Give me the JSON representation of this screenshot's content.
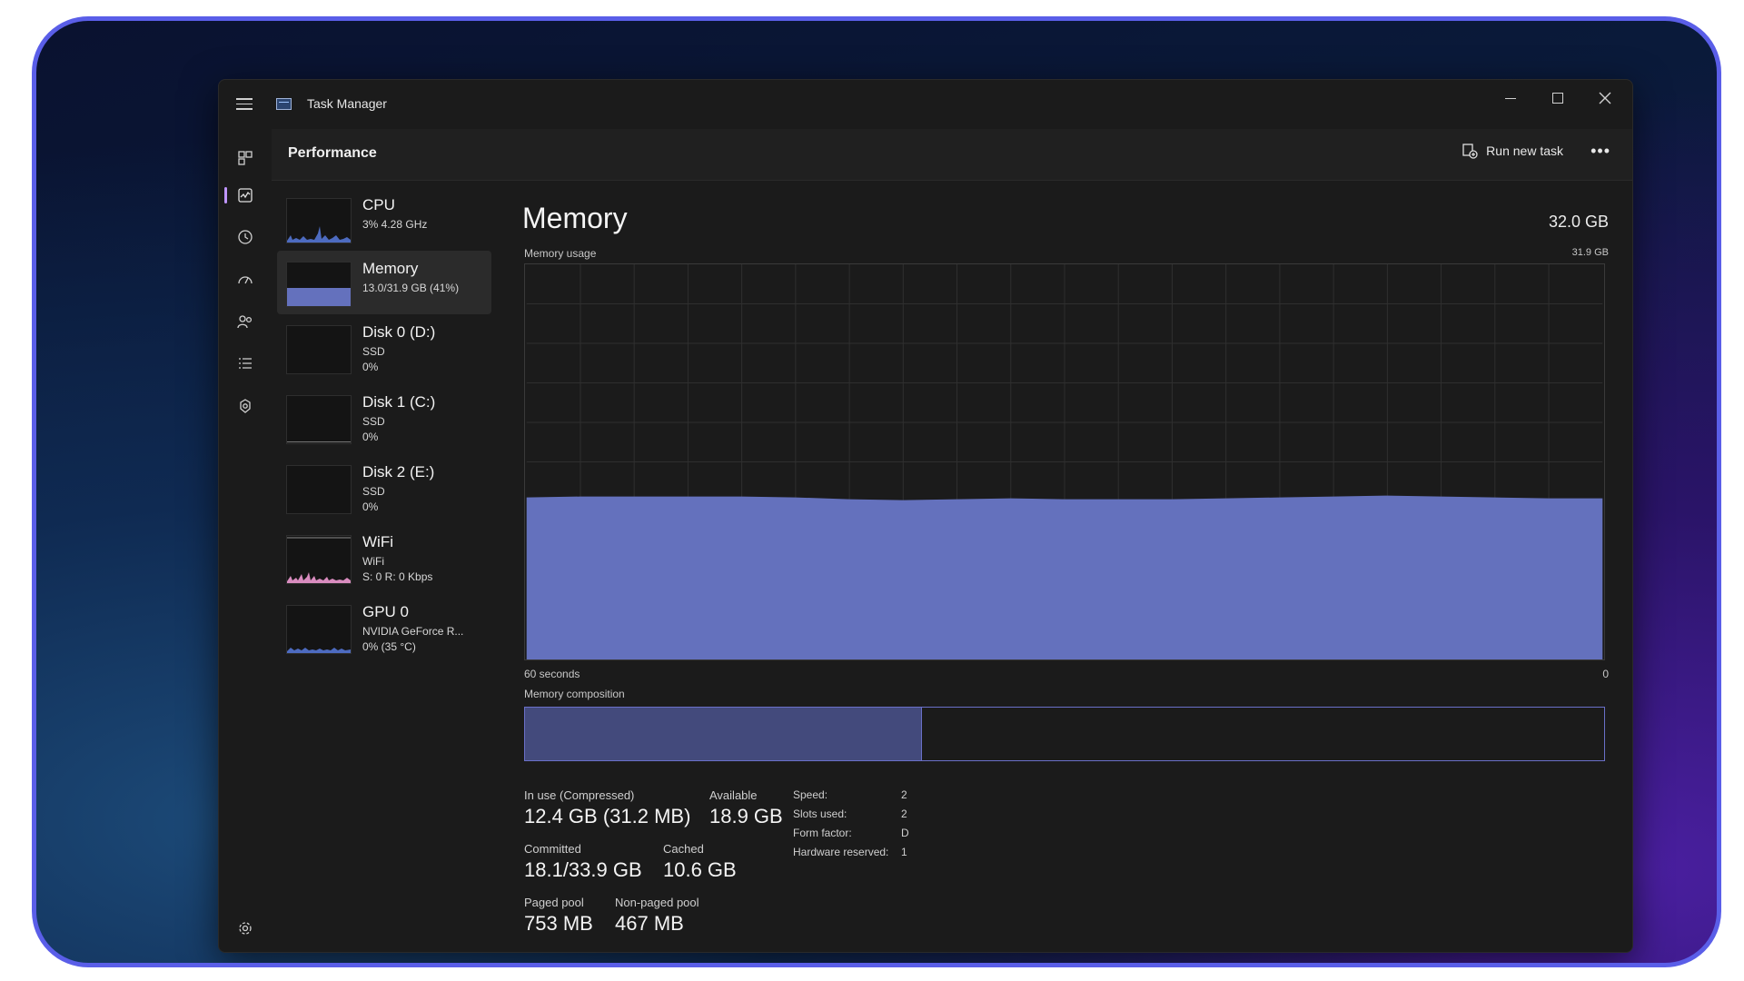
{
  "window": {
    "title": "Task Manager"
  },
  "header": {
    "title": "Performance",
    "run_new_task": "Run new task",
    "more": "•••"
  },
  "colors": {
    "memory_fill": "#6471bd",
    "accent": "#bf95ff",
    "disk_line": "#7a7a7a",
    "wifi_line": "#d98cbf"
  },
  "devices": [
    {
      "name": "CPU",
      "line1": "3% 4.28 GHz",
      "line2": ""
    },
    {
      "name": "Memory",
      "line1": "13.0/31.9 GB (41%)",
      "line2": ""
    },
    {
      "name": "Disk 0 (D:)",
      "line1": "SSD",
      "line2": "0%"
    },
    {
      "name": "Disk 1 (C:)",
      "line1": "SSD",
      "line2": "0%"
    },
    {
      "name": "Disk 2 (E:)",
      "line1": "SSD",
      "line2": "0%"
    },
    {
      "name": "WiFi",
      "line1": "WiFi",
      "line2": "S: 0 R: 0 Kbps"
    },
    {
      "name": "GPU 0",
      "line1": "NVIDIA GeForce R...",
      "line2": "0% (35 °C)"
    }
  ],
  "memory": {
    "title": "Memory",
    "total": "32.0 GB",
    "usage_label": "Memory usage",
    "usage_max": "31.9 GB",
    "axis_left": "60 seconds",
    "axis_right": "0",
    "composition_label": "Memory composition",
    "in_use_fraction": 0.367,
    "usage_fraction": 0.41,
    "stats": {
      "in_use_label": "In use (Compressed)",
      "in_use_value": "12.4 GB (31.2 MB)",
      "available_label": "Available",
      "available_value": "18.9 GB",
      "committed_label": "Committed",
      "committed_value": "18.1/33.9 GB",
      "cached_label": "Cached",
      "cached_value": "10.6 GB",
      "paged_label": "Paged pool",
      "paged_value": "753 MB",
      "nonpaged_label": "Non-paged pool",
      "nonpaged_value": "467 MB"
    },
    "hw": {
      "speed_label": "Speed:",
      "speed_value": "2",
      "slots_label": "Slots used:",
      "slots_value": "2",
      "form_label": "Form factor:",
      "form_value": "D",
      "reserved_label": "Hardware reserved:",
      "reserved_value": "1"
    }
  }
}
